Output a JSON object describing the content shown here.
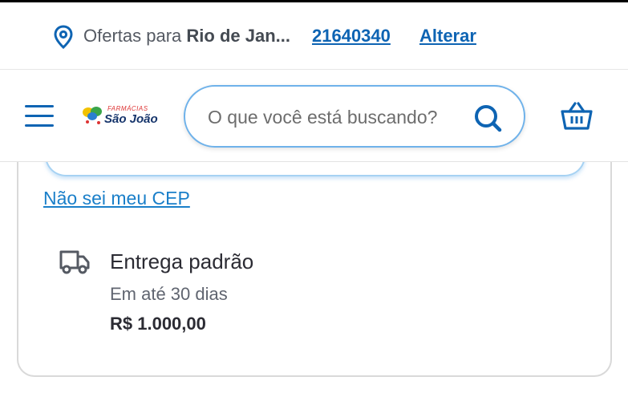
{
  "location_bar": {
    "prefix": "Ofertas para ",
    "city": "Rio de Jan...",
    "cep": "21640340",
    "change_label": "Alterar",
    "icon": "location-pin-icon"
  },
  "header": {
    "menu_icon": "hamburger-menu-icon",
    "logo": {
      "top_text": "FARMÁCIAS",
      "main_text": "São João"
    },
    "search": {
      "placeholder": "O que você está buscando?",
      "icon": "search-icon"
    },
    "cart_icon": "basket-icon"
  },
  "shipping": {
    "unknown_cep_link": "Não sei meu CEP",
    "option": {
      "icon": "truck-icon",
      "title": "Entrega padrão",
      "eta": "Em até 30 dias",
      "price": "R$ 1.000,00"
    }
  },
  "colors": {
    "brand_blue": "#0e64b3",
    "link_blue": "#1a7fc9",
    "search_border": "#6fb2ea",
    "text_dark": "#2b2b33"
  }
}
